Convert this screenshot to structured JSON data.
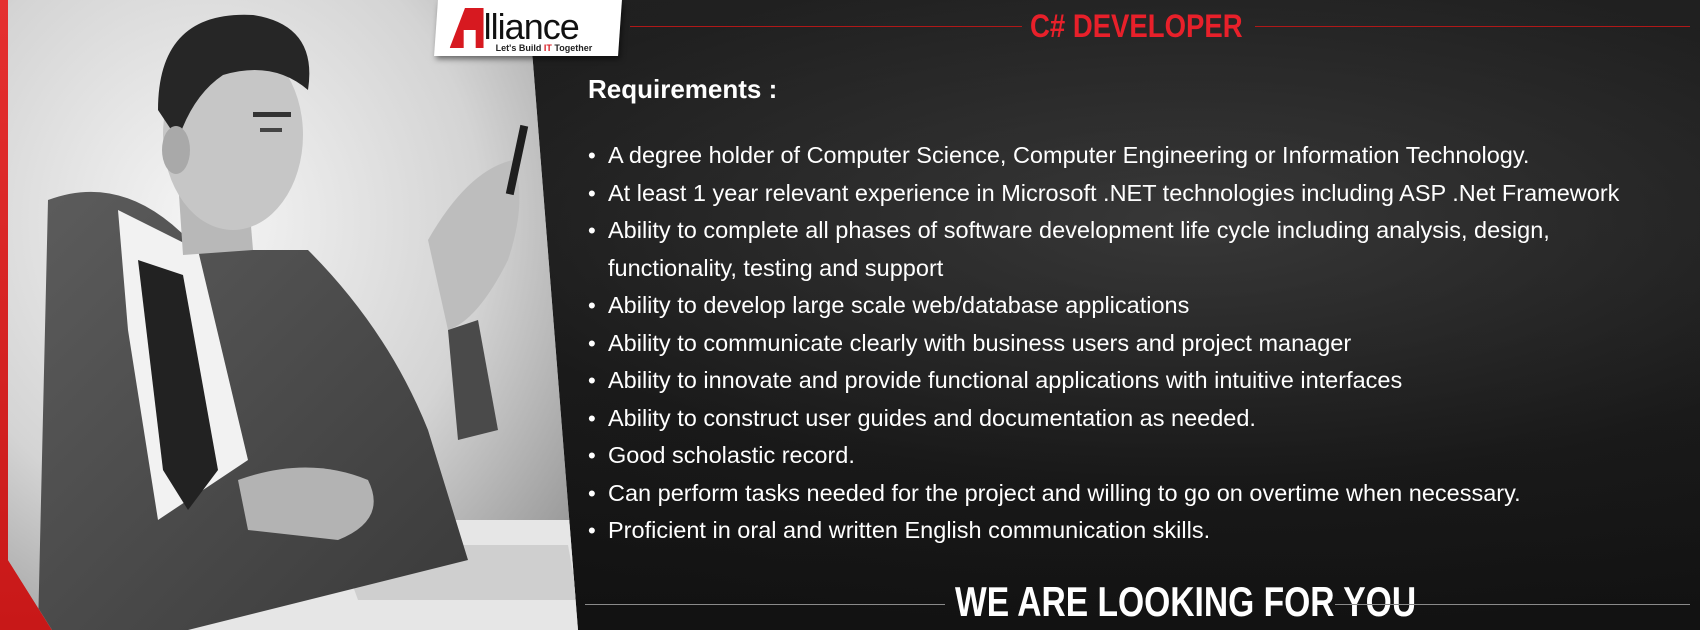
{
  "brand": {
    "name": "lliance",
    "tagline_before": "Let's Build",
    "tagline_highlight": "IT",
    "tagline_after": "Together",
    "accent_color": "#d71920"
  },
  "job_title": "C# DEVELOPER",
  "requirements_heading": "Requirements :",
  "requirements": [
    "A degree holder of Computer Science, Computer Engineering or Information Technology.",
    "At least 1 year relevant experience in Microsoft .NET technologies including ASP .Net Framework",
    "Ability to complete all phases of software development life cycle including analysis, design,",
    "functionality, testing and support",
    "Ability to develop large scale web/database applications",
    "Ability to communicate clearly with business users and project manager",
    "Ability to innovate and provide functional applications with intuitive interfaces",
    "Ability to construct user guides and documentation as needed.",
    "Good scholastic record.",
    "Can perform tasks needed for the project and willing to go on overtime when necessary.",
    "Proficient in oral and written English communication skills."
  ],
  "bullet_glyph": "•",
  "footer_text": "WE ARE LOOKING FOR YOU",
  "photo_subject": "man-at-desk-photo"
}
